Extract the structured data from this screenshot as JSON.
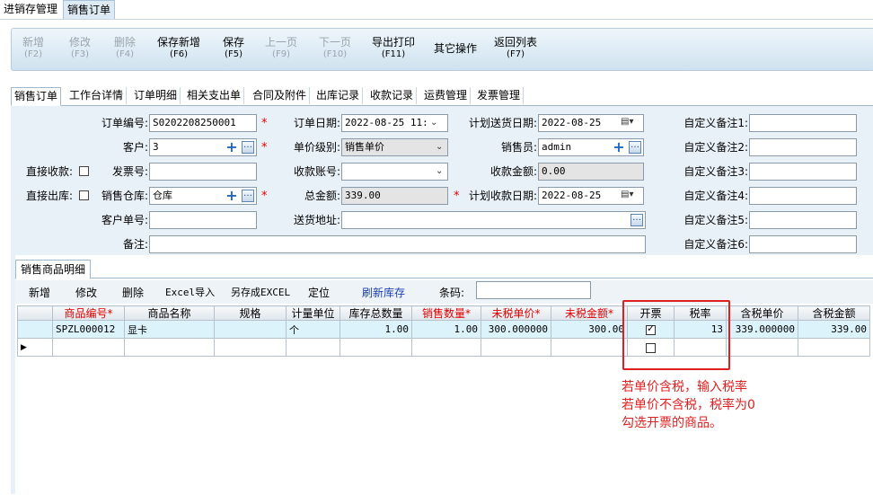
{
  "top_tabs": [
    "进销存管理",
    "销售订单"
  ],
  "toolbar": [
    {
      "label": "新增",
      "key": "(F2)",
      "enabled": false
    },
    {
      "label": "修改",
      "key": "(F3)",
      "enabled": false
    },
    {
      "label": "删除",
      "key": "(F4)",
      "enabled": false
    },
    {
      "label": "保存新增",
      "key": "(F6)",
      "enabled": true
    },
    {
      "label": "保存",
      "key": "(F5)",
      "enabled": true
    },
    {
      "label": "上一页",
      "key": "(F9)",
      "enabled": false
    },
    {
      "label": "下一页",
      "key": "(F10)",
      "enabled": false
    },
    {
      "label": "导出打印",
      "key": "(F11)",
      "enabled": true
    },
    {
      "label": "其它操作",
      "key": "",
      "enabled": true
    },
    {
      "label": "返回列表",
      "key": "(F7)",
      "enabled": true
    }
  ],
  "sub_tabs": [
    "销售订单",
    "工作台详情",
    "订单明细",
    "相关支出单",
    "合同及附件",
    "出库记录",
    "收款记录",
    "运费管理",
    "发票管理"
  ],
  "form": {
    "order_no_label": "订单编号:",
    "order_no": "S0202208250001",
    "customer_label": "客户:",
    "customer": "3",
    "direct_receipt_label": "直接收款:",
    "invoice_no_label": "发票号:",
    "invoice_no": "",
    "direct_out_label": "直接出库:",
    "warehouse_label": "销售仓库:",
    "warehouse": "仓库",
    "customer_no_label": "客户单号:",
    "customer_no": "",
    "remark_label": "备注:",
    "remark": "",
    "order_date_label": "订单日期:",
    "order_date": "2022-08-25 11:",
    "price_level_label": "单价级别:",
    "price_level": "销售单价",
    "receipt_account_label": "收款账号:",
    "receipt_account": "",
    "total_label": "总金额:",
    "total": "339.00",
    "address_label": "送货地址:",
    "address": "",
    "delivery_date_label": "计划送货日期:",
    "delivery_date": "2022-08-25",
    "salesperson_label": "销售员:",
    "salesperson": "admin",
    "receipt_amount_label": "收款金额:",
    "receipt_amount": "0.00",
    "payment_date_label": "计划收款日期:",
    "payment_date": "2022-08-25",
    "custom_labels": [
      "自定义备注1:",
      "自定义备注2:",
      "自定义备注3:",
      "自定义备注4:",
      "自定义备注5:",
      "自定义备注6:"
    ],
    "required_mark": "*"
  },
  "grid_tab": "销售商品明细",
  "grid_toolbar": {
    "new": "新增",
    "edit": "修改",
    "delete": "删除",
    "excel_import": "Excel导入",
    "save_excel": "另存成EXCEL",
    "locate": "定位",
    "refresh_stock": "刷新库存",
    "barcode_label": "条码:",
    "barcode": ""
  },
  "grid": {
    "headers": [
      "商品编号*",
      "商品名称",
      "规格",
      "计量单位",
      "库存总数量",
      "销售数量*",
      "未税单价*",
      "未税金额*",
      "开票",
      "税率",
      "含税单价",
      "含税金额"
    ],
    "rows": [
      {
        "code": "SPZL000012",
        "name": "显卡",
        "spec": "",
        "unit": "个",
        "stock": "1.00",
        "qty": "1.00",
        "price": "300.000000",
        "amount": "300.00",
        "invoice": true,
        "tax": "13",
        "tax_price": "339.000000",
        "tax_amount": "339.00"
      }
    ]
  },
  "notes": [
    "若单价含税，输入税率",
    "若单价不含税，税率为0",
    "勾选开票的商品。"
  ],
  "colors": {
    "required": "#e00000",
    "annotation": "#e02020",
    "selected_row": "#dcf3fb"
  }
}
